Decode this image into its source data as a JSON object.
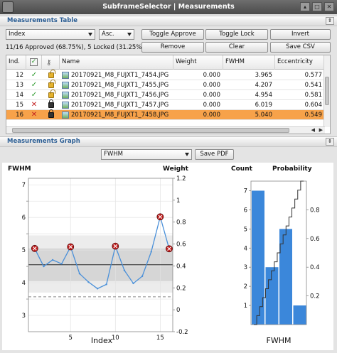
{
  "window": {
    "title": "SubframeSelector | Measurements"
  },
  "table_section": {
    "title": "Measurements Table"
  },
  "controls": {
    "sort_field": "Index",
    "sort_order": "Asc.",
    "toggle_approve": "Toggle Approve",
    "toggle_lock": "Toggle Lock",
    "invert": "Invert",
    "remove": "Remove",
    "clear": "Clear",
    "save_csv": "Save CSV",
    "status": "11/16 Approved (68.75%), 5 Locked (31.25%)"
  },
  "table": {
    "headers": {
      "index": "Ind.",
      "name": "Name",
      "weight": "Weight",
      "fwhm": "FWHM",
      "eccentricity": "Eccentricity"
    },
    "rows": [
      {
        "index": "12",
        "approved": true,
        "locked": false,
        "name": "20170921_M8_FUJXT1_7454.JPG",
        "weight": "0.000",
        "fwhm": "3.965",
        "eccentricity": "0.577",
        "selected": false
      },
      {
        "index": "13",
        "approved": true,
        "locked": false,
        "name": "20170921_M8_FUJXT1_7455.JPG",
        "weight": "0.000",
        "fwhm": "4.207",
        "eccentricity": "0.541",
        "selected": false
      },
      {
        "index": "14",
        "approved": true,
        "locked": false,
        "name": "20170921_M8_FUJXT1_7456.JPG",
        "weight": "0.000",
        "fwhm": "4.954",
        "eccentricity": "0.581",
        "selected": false
      },
      {
        "index": "15",
        "approved": false,
        "locked": true,
        "name": "20170921_M8_FUJXT1_7457.JPG",
        "weight": "0.000",
        "fwhm": "6.019",
        "eccentricity": "0.604",
        "selected": false
      },
      {
        "index": "16",
        "approved": false,
        "locked": true,
        "name": "20170921_M8_FUJXT1_7458.JPG",
        "weight": "0.000",
        "fwhm": "5.040",
        "eccentricity": "0.549",
        "selected": true
      }
    ]
  },
  "graph_section": {
    "title": "Measurements Graph"
  },
  "graph_controls": {
    "property": "FWHM",
    "save_pdf": "Save PDF"
  },
  "colors": {
    "accent": "#2b5d93",
    "selection": "#f7a24a",
    "series": "#4a90d9",
    "bar": "#3b87da",
    "approve": "#2a9a2a",
    "reject": "#c21f1f"
  },
  "chart_data": [
    {
      "type": "line",
      "ylabel": "FWHM",
      "y2label": "Weight",
      "xlabel": "Index",
      "x": [
        1,
        2,
        3,
        4,
        5,
        6,
        7,
        8,
        9,
        10,
        11,
        12,
        13,
        14,
        15,
        16
      ],
      "series": [
        {
          "values": [
            5.05,
            4.5,
            4.7,
            4.58,
            5.1,
            4.28,
            4.02,
            3.82,
            3.95,
            5.12,
            4.38,
            3.98,
            4.2,
            4.95,
            6.02,
            5.04
          ]
        }
      ],
      "rejected_x": [
        1,
        5,
        10,
        15,
        16
      ],
      "median": 4.55,
      "bands": [
        [
          3.7,
          5.45
        ],
        [
          4.05,
          5.05
        ]
      ],
      "dashed_line": 3.57,
      "ylim": [
        2.5,
        7.2
      ],
      "y2lim": [
        -0.2,
        1.2
      ],
      "xticks": [
        "5",
        "10",
        "15"
      ],
      "yticks": [
        "3",
        "3.5",
        "4",
        "4.5",
        "5",
        "5.5",
        "6",
        "6.5",
        "7"
      ],
      "y2ticks": [
        "-0.2",
        "0",
        "0.2",
        "0.4",
        "0.6",
        "0.8",
        "1",
        "1.2"
      ],
      "grid": true
    },
    {
      "type": "bar",
      "ylabel": "Count",
      "y2label": "Probability",
      "xlabel": "FWHM",
      "bins": [
        7,
        3,
        5,
        1
      ],
      "cumulative_steps": 16,
      "ylim": [
        0,
        7.5
      ],
      "y2lim": [
        0,
        1
      ],
      "yticks": [
        "1",
        "2",
        "3",
        "4",
        "5",
        "6",
        "7"
      ],
      "y2ticks": [
        "0.2",
        "0.4",
        "0.6",
        "0.8"
      ]
    }
  ]
}
